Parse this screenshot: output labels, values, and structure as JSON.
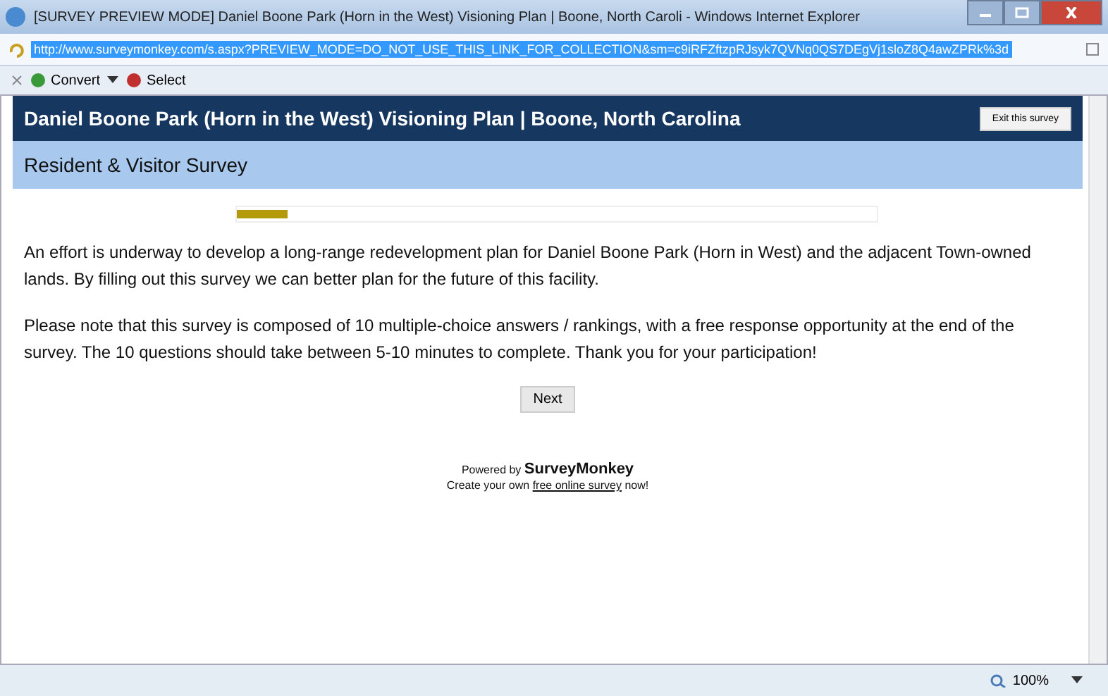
{
  "window": {
    "title": "[SURVEY PREVIEW MODE] Daniel Boone Park (Horn in the West) Visioning Plan | Boone, North Caroli - Windows Internet Explorer"
  },
  "address_bar": {
    "url": "http://www.surveymonkey.com/s.aspx?PREVIEW_MODE=DO_NOT_USE_THIS_LINK_FOR_COLLECTION&sm=c9iRFZftzpRJsyk7QVNq0QS7DEgVj1sloZ8Q4awZPRk%3d"
  },
  "toolbar": {
    "items": [
      {
        "label": "Convert",
        "dropdown": true
      },
      {
        "label": "Select",
        "dropdown": false
      }
    ]
  },
  "survey": {
    "title": "Daniel Boone Park (Horn in the West) Visioning Plan | Boone, North Carolina",
    "exit_button": "Exit this survey",
    "page_title": "Resident & Visitor Survey",
    "progress": {
      "level": 0.08
    },
    "paragraphs": [
      "An effort is underway to develop a long-range redevelopment plan for Daniel Boone Park (Horn in West) and the adjacent Town-owned lands. By filling out this survey we can better plan for the future of this facility.",
      "Please note that this survey is composed of 10 multiple-choice answers / rankings, with a free response opportunity at the end of the survey. The 10 questions should take between 5-10 minutes to complete. Thank you for your participation!"
    ],
    "next_button": "Next",
    "powered_by": "Powered by **SurveyMonkey**",
    "create_line": {
      "before": "Create your own",
      "link": "free online survey",
      "after": "now!"
    }
  },
  "status_bar": {
    "zoom": "100%"
  }
}
